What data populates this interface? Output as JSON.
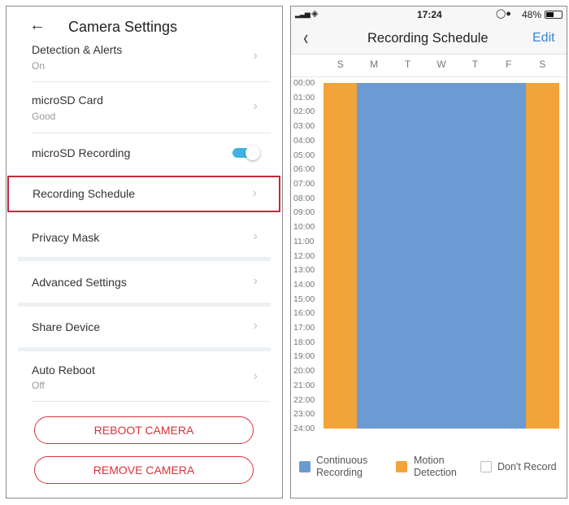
{
  "left": {
    "title": "Camera Settings",
    "rows": [
      {
        "label": "Detection & Alerts",
        "sub": "On"
      },
      {
        "label": "microSD Card",
        "sub": "Good"
      },
      {
        "label": "microSD Recording",
        "toggle": true
      },
      {
        "label": "Recording Schedule"
      },
      {
        "label": "Privacy Mask"
      },
      {
        "label": "Advanced Settings"
      },
      {
        "label": "Share Device"
      },
      {
        "label": "Auto Reboot",
        "sub": "Off"
      }
    ],
    "reboot_label": "REBOOT CAMERA",
    "remove_label": "REMOVE CAMERA",
    "highlight_color": "#c8283a",
    "toggle_color": "#3fb3e0"
  },
  "right": {
    "status": {
      "time": "17:24",
      "battery": "48%"
    },
    "title": "Recording Schedule",
    "edit_label": "Edit",
    "days": [
      "S",
      "M",
      "T",
      "W",
      "T",
      "F",
      "S"
    ],
    "hours": [
      "00:00",
      "01:00",
      "02:00",
      "03:00",
      "04:00",
      "05:00",
      "06:00",
      "07:00",
      "08:00",
      "09:00",
      "10:00",
      "11:00",
      "12:00",
      "13:00",
      "14:00",
      "15:00",
      "16:00",
      "17:00",
      "18:00",
      "19:00",
      "20:00",
      "21:00",
      "22:00",
      "23:00",
      "24:00"
    ],
    "schedule": [
      "motion",
      "continuous",
      "continuous",
      "continuous",
      "continuous",
      "continuous",
      "motion"
    ],
    "colors": {
      "continuous": "#6b9bd2",
      "motion": "#f2a33a"
    },
    "legend": {
      "continuous": "Continuous Recording",
      "motion": "Motion Detection",
      "none": "Don't Record"
    }
  }
}
